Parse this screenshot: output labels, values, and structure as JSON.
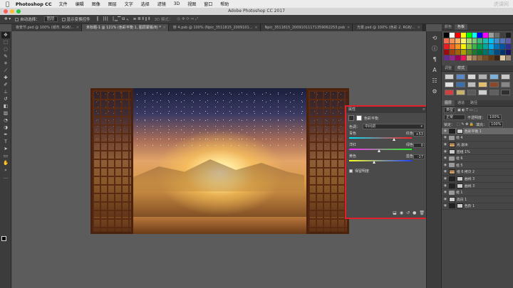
{
  "menubar": {
    "app_name": "Photoshop CC",
    "items": [
      "文件",
      "编辑",
      "图像",
      "图层",
      "文字",
      "选择",
      "滤镜",
      "3D",
      "视图",
      "窗口",
      "帮助"
    ],
    "watermark": "虎课网"
  },
  "window": {
    "title": "Adobe Photoshop CC 2017"
  },
  "options_bar": {
    "auto_select_label": "自动选择：",
    "auto_select_value": "图层",
    "show_transform_label": "显示变换控件",
    "mode_3d_label": "3D 模式："
  },
  "tabs": [
    {
      "label": "夜景节.psd @ 100% (城市, RGB/...",
      "active": false
    },
    {
      "label": "未标题-1 @ 121% (色彩平衡 1, 图层蒙版/8) *",
      "active": true
    },
    {
      "label": "桥 4.psb @ 100% (Npic_3511815_2009101...",
      "active": false
    },
    {
      "label": "Npic_3511815_20091011171359062253.psb",
      "active": false
    },
    {
      "label": "光晕.psd @ 100% (色彩 2, RGB/...",
      "active": false
    }
  ],
  "tools": [
    {
      "name": "move-tool-icon",
      "glyph": "✥",
      "active": true
    },
    {
      "name": "marquee-tool-icon",
      "glyph": "⬚",
      "active": false
    },
    {
      "name": "lasso-tool-icon",
      "glyph": "◌",
      "active": false
    },
    {
      "name": "quick-select-tool-icon",
      "glyph": "✎",
      "active": false
    },
    {
      "name": "crop-tool-icon",
      "glyph": "⌗",
      "active": false
    },
    {
      "name": "eyedropper-tool-icon",
      "glyph": "⟋",
      "active": false
    },
    {
      "name": "healing-tool-icon",
      "glyph": "✚",
      "active": false
    },
    {
      "name": "brush-tool-icon",
      "glyph": "✐",
      "active": false
    },
    {
      "name": "stamp-tool-icon",
      "glyph": "⊥",
      "active": false
    },
    {
      "name": "history-brush-tool-icon",
      "glyph": "↺",
      "active": false
    },
    {
      "name": "eraser-tool-icon",
      "glyph": "◧",
      "active": false
    },
    {
      "name": "gradient-tool-icon",
      "glyph": "▥",
      "active": false
    },
    {
      "name": "blur-tool-icon",
      "glyph": "◔",
      "active": false
    },
    {
      "name": "dodge-tool-icon",
      "glyph": "◑",
      "active": false
    },
    {
      "name": "pen-tool-icon",
      "glyph": "✒",
      "active": false
    },
    {
      "name": "type-tool-icon",
      "glyph": "T",
      "active": false
    },
    {
      "name": "path-select-tool-icon",
      "glyph": "➤",
      "active": false
    },
    {
      "name": "shape-tool-icon",
      "glyph": "▭",
      "active": false
    },
    {
      "name": "hand-tool-icon",
      "glyph": "✋",
      "active": false
    },
    {
      "name": "zoom-tool-icon",
      "glyph": "⌕",
      "active": false
    },
    {
      "name": "more-tools-icon",
      "glyph": "…",
      "active": false
    }
  ],
  "properties": {
    "panel_title": "属性",
    "subtitle": "色彩平衡",
    "tone_label": "色调：",
    "tone_value": "中间调",
    "sliders": [
      {
        "left": "青色",
        "right": "红色",
        "value": "+53",
        "track": "cr",
        "pos": 0.76
      },
      {
        "left": "洋红",
        "right": "绿色",
        "value": "0",
        "track": "mg",
        "pos": 0.5
      },
      {
        "left": "黄色",
        "right": "蓝色",
        "value": "-17",
        "track": "yb",
        "pos": 0.42
      }
    ],
    "preserve_label": "保留明度"
  },
  "swatches_panel": {
    "tabs": [
      "颜色",
      "色板"
    ],
    "colors": [
      "#000000",
      "#ffffff",
      "#ff0000",
      "#ffff00",
      "#00ff00",
      "#00ffff",
      "#0000ff",
      "#ff00ff",
      "#9e9e9e",
      "#6c6c6c",
      "#404040",
      "#1e1e1e",
      "#f26c4f",
      "#f68e55",
      "#fbaf5c",
      "#fff467",
      "#acd372",
      "#7cc576",
      "#3bb878",
      "#1abbb4",
      "#00bff3",
      "#438ccb",
      "#5574b9",
      "#605ca8",
      "#ed1c24",
      "#f26522",
      "#f7941d",
      "#fff200",
      "#8dc63f",
      "#39b54a",
      "#00a651",
      "#00a99d",
      "#00aeef",
      "#0072bc",
      "#0054a6",
      "#2e3192",
      "#9e0b0f",
      "#a0410d",
      "#a36209",
      "#aba000",
      "#598527",
      "#1a7b30",
      "#007236",
      "#00746b",
      "#0076a3",
      "#004b80",
      "#003471",
      "#1b1464",
      "#662d91",
      "#92278f",
      "#9e005d",
      "#ed145b",
      "#c69c6d",
      "#a67c52",
      "#8c6239",
      "#754c24",
      "#603913",
      "#3c2415",
      "#e1c7a1",
      "#998675"
    ]
  },
  "styles_panel": {
    "tabs": [
      "调整",
      "样式"
    ],
    "styles": [
      "#cfcfcf",
      "#5a88c8",
      "#d8d8d8",
      "#b0b0b0",
      "#7fb0d8",
      "#c8c8c8",
      "#e0e0e0",
      "#3a6ea8",
      "#bdbdbd",
      "#e0c070",
      "#8a4a2a",
      "#888888",
      "#d04040",
      "#c8b070",
      "#5a5a5a",
      "#d0d0d0",
      "#606060",
      "#303030"
    ]
  },
  "layers_panel": {
    "tabs": [
      "图层",
      "通道",
      "路径"
    ],
    "kind_label": "类型",
    "blend_mode": "正常",
    "opacity_label": "不透明度：",
    "opacity": "100%",
    "lock_label": "锁定：",
    "fill_label": "填充：",
    "fill": "100%",
    "layers": [
      {
        "name": "色彩平衡 1",
        "type": "adjust",
        "selected": true
      },
      {
        "name": "组 4",
        "type": "group",
        "selected": false
      },
      {
        "name": "光 副本",
        "type": "image",
        "selected": false
      },
      {
        "name": "图组 1%",
        "type": "light",
        "selected": false
      },
      {
        "name": "组 6",
        "type": "group",
        "selected": false
      },
      {
        "name": "组 5",
        "type": "group",
        "selected": false
      },
      {
        "name": "组 6 拷贝 2",
        "type": "image",
        "selected": false
      },
      {
        "name": "曲线 3",
        "type": "adjust",
        "selected": false
      },
      {
        "name": "曲线 3",
        "type": "adjust",
        "selected": false
      },
      {
        "name": "组 1",
        "type": "group",
        "selected": false
      },
      {
        "name": "亮白 1",
        "type": "light",
        "selected": false
      },
      {
        "name": "色阶 1",
        "type": "adjust",
        "selected": false
      }
    ]
  }
}
